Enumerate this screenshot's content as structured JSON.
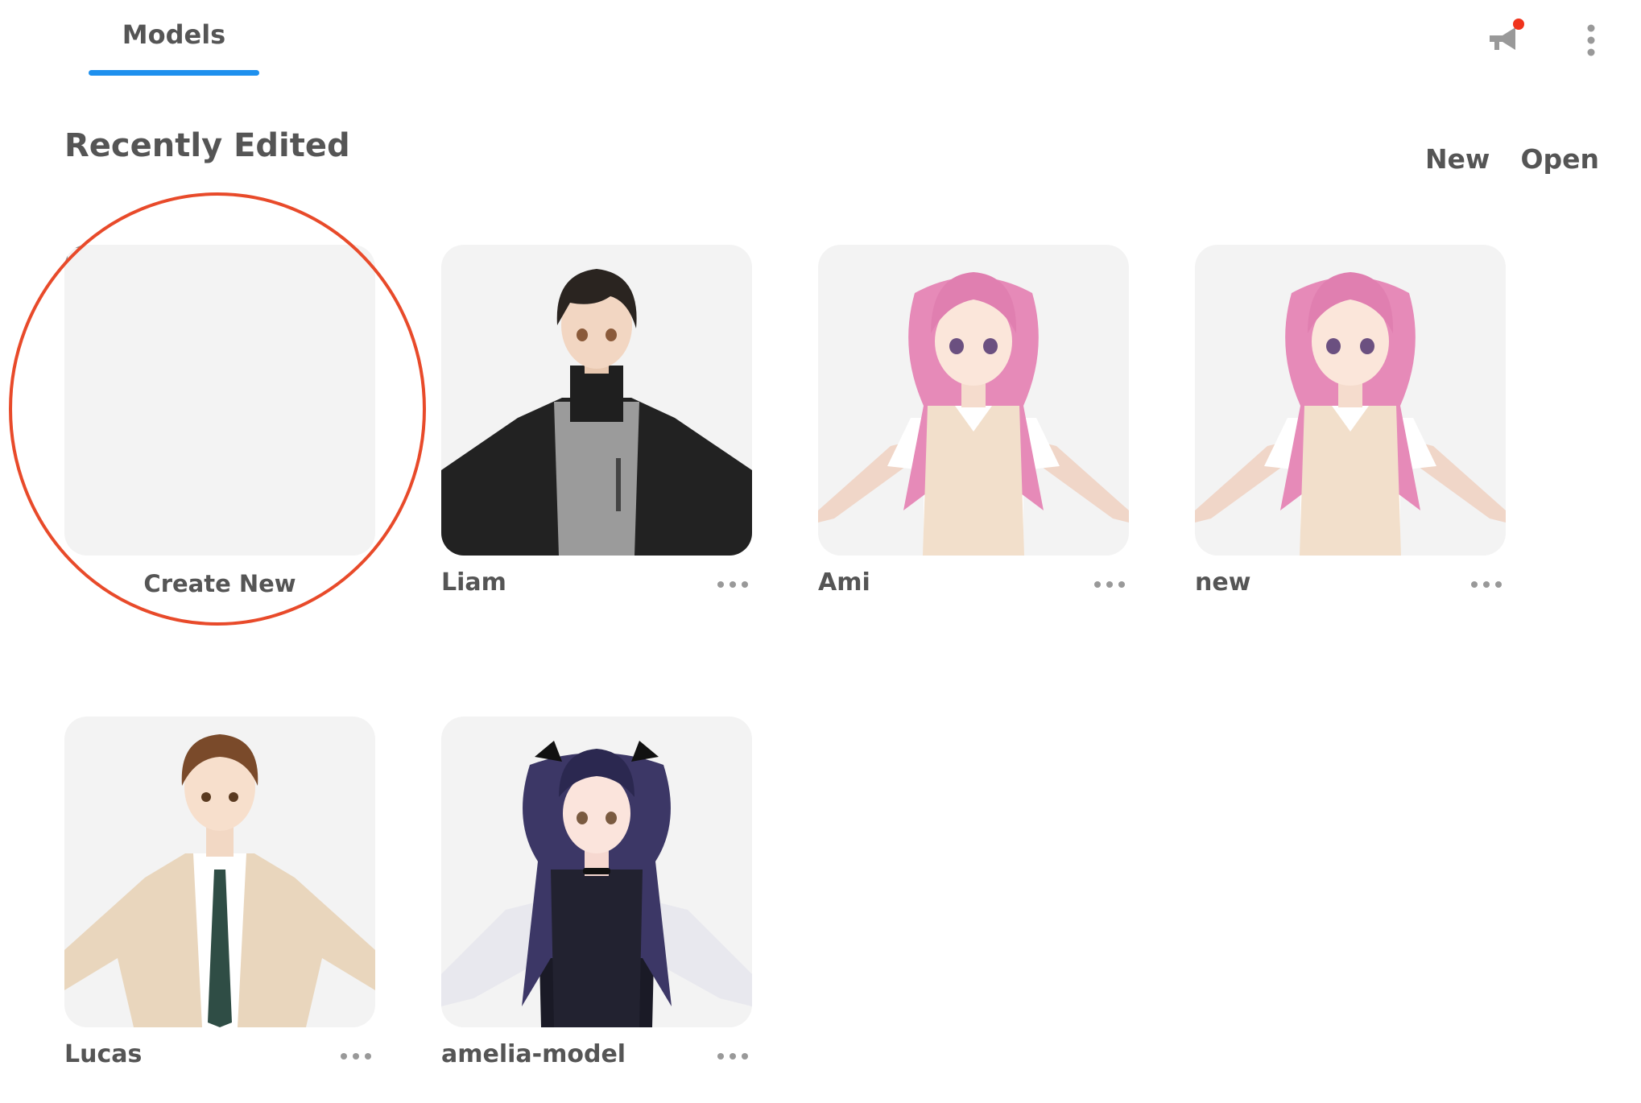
{
  "tabs": [
    {
      "label": "Models",
      "active": true
    }
  ],
  "header_icons": [
    "announcement-icon",
    "kebab-menu-icon"
  ],
  "notification_dot_color": "#f0331c",
  "accent_color": "#1e90ee",
  "highlight_color": "#e84a2a",
  "section": {
    "title": "Recently Edited"
  },
  "actions": {
    "new_label": "New",
    "open_label": "Open"
  },
  "create_card": {
    "label": "Create New"
  },
  "models": [
    {
      "name": "Liam"
    },
    {
      "name": "Ami"
    },
    {
      "name": "new"
    },
    {
      "name": "Lucas"
    },
    {
      "name": "amelia-model"
    }
  ]
}
